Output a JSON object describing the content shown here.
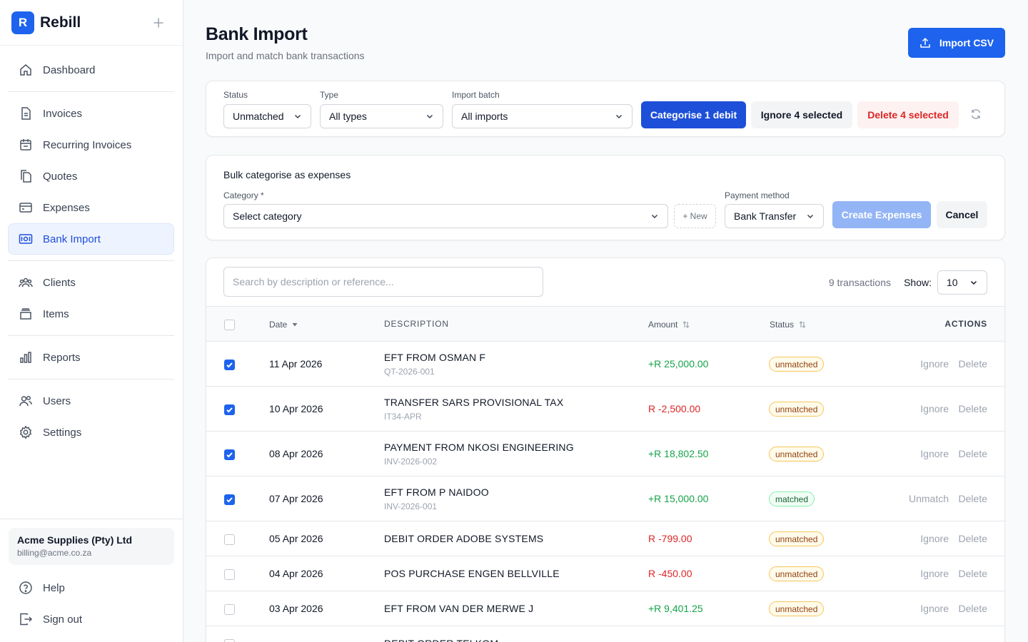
{
  "app": {
    "logo_letter": "R",
    "name": "Rebill"
  },
  "sidebar": {
    "nav": [
      {
        "label": "Dashboard",
        "icon": "home-icon"
      },
      {
        "label": "Invoices",
        "icon": "file-icon"
      },
      {
        "label": "Recurring Invoices",
        "icon": "calendar-icon"
      },
      {
        "label": "Quotes",
        "icon": "copy-icon"
      },
      {
        "label": "Expenses",
        "icon": "card-icon"
      },
      {
        "label": "Bank Import",
        "icon": "bank-note-icon",
        "active": true
      },
      {
        "label": "Clients",
        "icon": "users-icon"
      },
      {
        "label": "Items",
        "icon": "box-icon"
      },
      {
        "label": "Reports",
        "icon": "bar-chart-icon"
      },
      {
        "label": "Users",
        "icon": "user-group-icon"
      },
      {
        "label": "Settings",
        "icon": "gear-icon"
      }
    ],
    "org": {
      "name": "Acme Supplies (Pty) Ltd",
      "email": "billing@acme.co.za"
    },
    "footer": [
      {
        "label": "Help",
        "icon": "help-icon"
      },
      {
        "label": "Sign out",
        "icon": "sign-out-icon"
      }
    ]
  },
  "header": {
    "title": "Bank Import",
    "subtitle": "Import and match bank transactions",
    "import_button": "Import CSV"
  },
  "filters": {
    "status": {
      "label": "Status",
      "value": "Unmatched"
    },
    "type": {
      "label": "Type",
      "value": "All types"
    },
    "batch": {
      "label": "Import batch",
      "value": "All imports"
    },
    "categorise_button": "Categorise 1 debit",
    "ignore_button": "Ignore 4 selected",
    "delete_button": "Delete 4 selected"
  },
  "bulk": {
    "title": "Bulk categorise as expenses",
    "category_label": "Category *",
    "category_value": "Select category",
    "new_button": "+ New",
    "payment_label": "Payment method",
    "payment_value": "Bank Transfer",
    "create_button": "Create Expenses",
    "cancel_button": "Cancel"
  },
  "table": {
    "search_placeholder": "Search by description or reference...",
    "count_text": "9 transactions",
    "show_label": "Show:",
    "show_value": "10",
    "columns": {
      "date": "Date",
      "description": "Description",
      "amount": "Amount",
      "status": "Status",
      "actions": "Actions"
    },
    "rows": [
      {
        "checked": true,
        "date": "11 Apr 2026",
        "description": "EFT FROM OSMAN F",
        "reference": "QT-2026-001",
        "amount": "+R 25,000.00",
        "direction": "credit",
        "status": "unmatched",
        "action1": "Ignore",
        "action2": "Delete"
      },
      {
        "checked": true,
        "date": "10 Apr 2026",
        "description": "TRANSFER SARS PROVISIONAL TAX",
        "reference": "IT34-APR",
        "amount": "R -2,500.00",
        "direction": "debit",
        "status": "unmatched",
        "action1": "Ignore",
        "action2": "Delete"
      },
      {
        "checked": true,
        "date": "08 Apr 2026",
        "description": "PAYMENT FROM NKOSI ENGINEERING",
        "reference": "INV-2026-002",
        "amount": "+R 18,802.50",
        "direction": "credit",
        "status": "unmatched",
        "action1": "Ignore",
        "action2": "Delete"
      },
      {
        "checked": true,
        "date": "07 Apr 2026",
        "description": "EFT FROM P NAIDOO",
        "reference": "INV-2026-001",
        "amount": "+R 15,000.00",
        "direction": "credit",
        "status": "matched",
        "action1": "Unmatch",
        "action2": "Delete"
      },
      {
        "checked": false,
        "date": "05 Apr 2026",
        "description": "DEBIT ORDER ADOBE SYSTEMS",
        "reference": "",
        "amount": "R -799.00",
        "direction": "debit",
        "status": "unmatched",
        "action1": "Ignore",
        "action2": "Delete"
      },
      {
        "checked": false,
        "date": "04 Apr 2026",
        "description": "POS PURCHASE ENGEN BELLVILLE",
        "reference": "",
        "amount": "R -450.00",
        "direction": "debit",
        "status": "unmatched",
        "action1": "Ignore",
        "action2": "Delete"
      },
      {
        "checked": false,
        "date": "03 Apr 2026",
        "description": "EFT FROM VAN DER MERWE J",
        "reference": "",
        "amount": "+R 9,401.25",
        "direction": "credit",
        "status": "unmatched",
        "action1": "Ignore",
        "action2": "Delete"
      },
      {
        "checked": false,
        "date": "",
        "description": "DEBIT ORDER TELKOM",
        "reference": "",
        "amount": "",
        "direction": "debit",
        "status": "",
        "action1": "",
        "action2": ""
      }
    ]
  },
  "colors": {
    "primary": "#1d63ed",
    "credit": "#16a34a",
    "debit": "#dc2626"
  }
}
